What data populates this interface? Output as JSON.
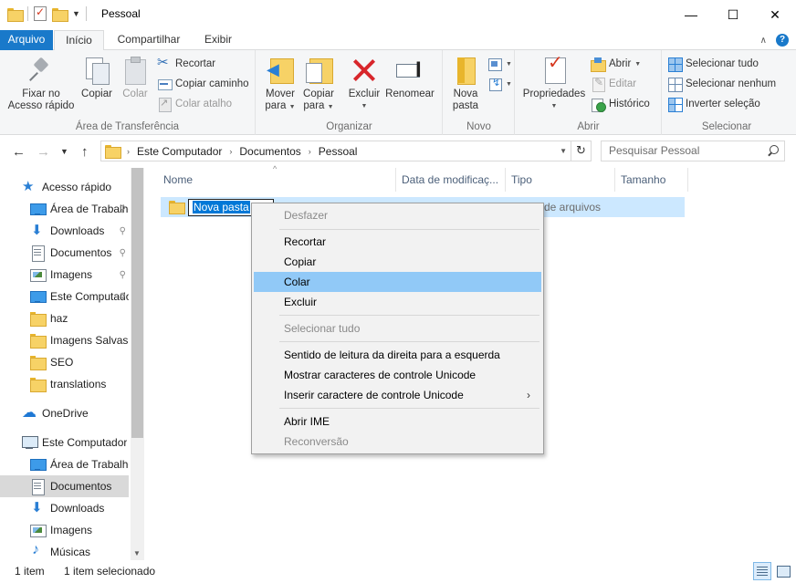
{
  "window": {
    "title": "Pessoal",
    "minimize_glyph": "—",
    "maximize_glyph": "☐",
    "close_glyph": "✕"
  },
  "ribbon_tabs": {
    "file": "Arquivo",
    "home": "Início",
    "share": "Compartilhar",
    "view": "Exibir",
    "help_glyph": "?"
  },
  "ribbon": {
    "clipboard": {
      "label": "Área de Transferência",
      "pin_line1": "Fixar no",
      "pin_line2": "Acesso rápido",
      "copy": "Copiar",
      "paste": "Colar",
      "cut": "Recortar",
      "copy_path": "Copiar caminho",
      "paste_shortcut": "Colar atalho"
    },
    "organize": {
      "label": "Organizar",
      "move_line1": "Mover",
      "move_line2": "para",
      "copy_line1": "Copiar",
      "copy_line2": "para",
      "delete": "Excluir",
      "rename": "Renomear"
    },
    "new": {
      "label": "Novo",
      "folder_line1": "Nova",
      "folder_line2": "pasta"
    },
    "open": {
      "label": "Abrir",
      "properties": "Propriedades",
      "open": "Abrir",
      "edit": "Editar",
      "history": "Histórico"
    },
    "select": {
      "label": "Selecionar",
      "select_all": "Selecionar tudo",
      "select_none": "Selecionar nenhum",
      "invert": "Inverter seleção"
    }
  },
  "address": {
    "crumbs": [
      "Este Computador",
      "Documentos",
      "Pessoal"
    ],
    "search_placeholder": "Pesquisar Pessoal"
  },
  "nav": {
    "quick_access": "Acesso rápido",
    "quick_items": [
      {
        "label": "Área de Trabalho",
        "icon": "desktop-icon",
        "pinned": true
      },
      {
        "label": "Downloads",
        "icon": "download-icon",
        "pinned": true
      },
      {
        "label": "Documentos",
        "icon": "documents-icon",
        "pinned": true
      },
      {
        "label": "Imagens",
        "icon": "pictures-icon",
        "pinned": true
      },
      {
        "label": "Este Computador",
        "icon": "computer-icon",
        "pinned": true
      },
      {
        "label": "haz",
        "icon": "folder-icon",
        "pinned": false
      },
      {
        "label": "Imagens Salvas",
        "icon": "folder-icon",
        "pinned": false
      },
      {
        "label": "SEO",
        "icon": "folder-icon",
        "pinned": false
      },
      {
        "label": "translations",
        "icon": "folder-icon",
        "pinned": false
      }
    ],
    "onedrive": "OneDrive",
    "this_pc": "Este Computador",
    "pc_items": [
      {
        "label": "Área de Trabalho",
        "icon": "desktop-icon"
      },
      {
        "label": "Documentos",
        "icon": "documents-icon",
        "selected": true
      },
      {
        "label": "Downloads",
        "icon": "download-icon"
      },
      {
        "label": "Imagens",
        "icon": "pictures-icon"
      },
      {
        "label": "Músicas",
        "icon": "music-icon"
      }
    ],
    "pin_glyph": "📌"
  },
  "columns": {
    "name": "Nome",
    "date": "Data de modificaç...",
    "type": "Tipo",
    "size": "Tamanho"
  },
  "files": [
    {
      "name": "Nova pasta",
      "type": "Pasta de arquivos",
      "visible_type": "de arquivos",
      "editing": true
    }
  ],
  "context_menu": {
    "items": [
      {
        "label": "Desfazer",
        "disabled": true
      },
      {
        "separator": true
      },
      {
        "label": "Recortar"
      },
      {
        "label": "Copiar"
      },
      {
        "label": "Colar",
        "hover": true
      },
      {
        "label": "Excluir"
      },
      {
        "separator": true
      },
      {
        "label": "Selecionar tudo",
        "disabled": true
      },
      {
        "separator": true
      },
      {
        "label": "Sentido de leitura da direita para a esquerda"
      },
      {
        "label": "Mostrar caracteres de controle Unicode"
      },
      {
        "label": "Inserir caractere de controle Unicode",
        "submenu": true
      },
      {
        "separator": true
      },
      {
        "label": "Abrir IME"
      },
      {
        "label": "Reconversão",
        "disabled": true
      }
    ]
  },
  "status": {
    "count": "1 item",
    "selected": "1 item selecionado"
  },
  "colors": {
    "accent": "#1979ca",
    "selection": "#cce8ff",
    "menu_hover": "#91c9f7",
    "delete_red": "#d8262b",
    "folder_yellow": "#f7d266"
  }
}
